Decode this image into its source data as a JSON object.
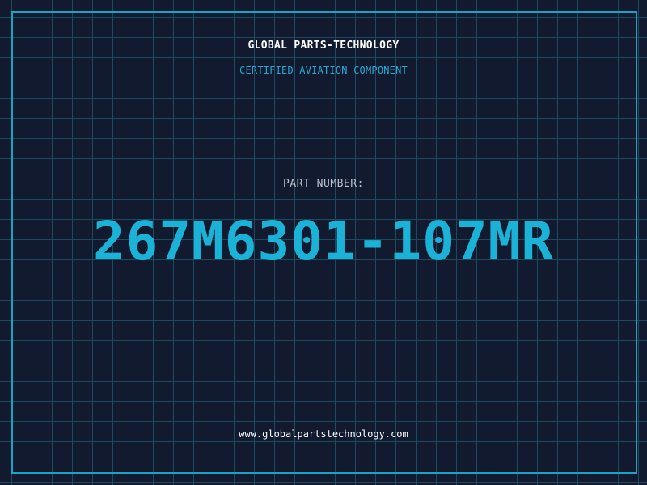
{
  "header": {
    "brand": "GLOBAL PARTS-TECHNOLOGY",
    "subtitle": "CERTIFIED AVIATION COMPONENT"
  },
  "part": {
    "label": "PART NUMBER:",
    "number": "267M6301-107MR"
  },
  "footer": {
    "website": "www.globalpartstechnology.com"
  },
  "colors": {
    "background": "#111a2f",
    "grid": "#1c4a5e",
    "accent": "#1ab2d6",
    "frame": "#1aa3c4"
  }
}
